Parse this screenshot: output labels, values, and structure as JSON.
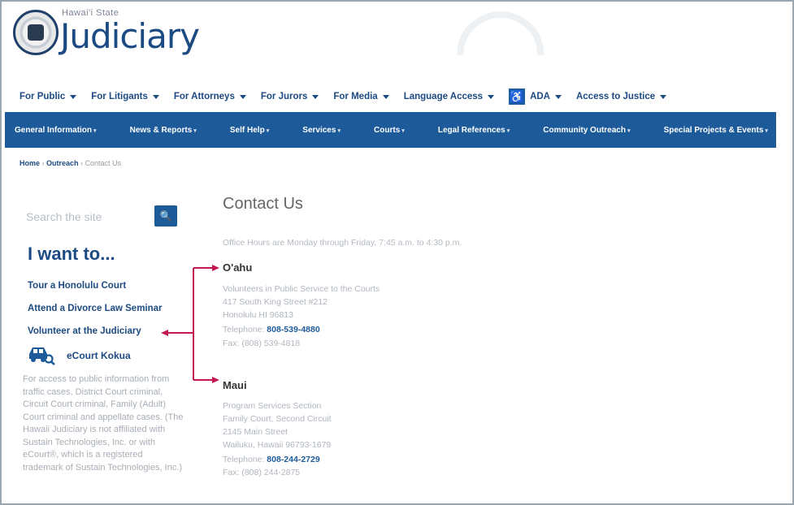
{
  "header": {
    "state_label": "Hawai'i State",
    "brand": "Judiciary"
  },
  "top_nav": [
    {
      "label": "For Public"
    },
    {
      "label": "For Litigants"
    },
    {
      "label": "For Attorneys"
    },
    {
      "label": "For Jurors"
    },
    {
      "label": "For Media"
    },
    {
      "label": "Language Access"
    },
    {
      "label": "ADA",
      "icon": "wheelchair-icon"
    },
    {
      "label": "Access to Justice"
    }
  ],
  "blue_nav": [
    "General Information",
    "News & Reports",
    "Self Help",
    "Services",
    "Courts",
    "Legal References",
    "Community Outreach",
    "Special Projects & Events"
  ],
  "breadcrumb": {
    "home": "Home",
    "sep": " › ",
    "outreach": "Outreach",
    "current": "Contact Us"
  },
  "sidebar": {
    "search_placeholder": "Search the site",
    "heading": "I want to...",
    "links": [
      "Tour a Honolulu Court",
      "Attend a Divorce Law Seminar",
      "Volunteer at the Judiciary"
    ],
    "ecourt_label": "eCourt Kokua",
    "paragraph": "For access to public information from traffic cases, District Court criminal, Circuit Court criminal, Family (Adult) Court criminal and appellate cases. (The Hawaii Judiciary is not affiliated with Sustain Technologies, Inc. or with eCourt®, which is a registered trademark of Sustain Technologies, Inc.)",
    "accent": "#c4174f"
  },
  "main": {
    "title": "Contact Us",
    "hours": "Office Hours are Monday through Friday, 7:45 a.m. to 4:30 p.m.",
    "offices": [
      {
        "name": "O'ahu",
        "lines": [
          "Volunteers in Public Service to the Courts",
          "417 South King Street #212",
          "Honolulu HI 96813"
        ],
        "phone_label": "Telephone: ",
        "phone": "808-539-4880",
        "fax": "Fax: (808) 539-4818"
      },
      {
        "name": "Maui",
        "lines": [
          "Program Services Section",
          "Family Court, Second Circuit",
          "2145 Main Street",
          "Wailuku, Hawaii 96793-1679"
        ],
        "phone_label": "Telephone: ",
        "phone": "808-244-2729",
        "fax": "Fax: (808) 244-2875"
      }
    ]
  },
  "colors": {
    "brand": "#1c4a82",
    "nav_bar": "#1c5a9a",
    "arrow": "#c4174f"
  }
}
